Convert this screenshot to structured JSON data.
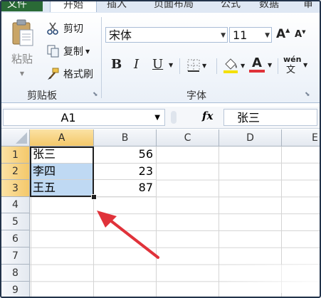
{
  "ribbon_tabs": [
    "文件",
    "开始",
    "插入",
    "页面布局",
    "公式",
    "数据",
    "审"
  ],
  "clipboard": {
    "paste_label": "粘贴",
    "cut_label": "剪切",
    "copy_label": "复制",
    "format_painter_label": "格式刷",
    "group_label": "剪贴板"
  },
  "font": {
    "name": "宋体",
    "size": "11",
    "bold_label": "B",
    "italic_label": "I",
    "underline_label": "U",
    "font_color_letter": "A",
    "grow_label": "A",
    "shrink_label": "A",
    "group_label": "字体",
    "phonetic_label": "wén"
  },
  "formula_bar": {
    "name_box": "A1",
    "fx_label": "fx",
    "content": "张三"
  },
  "columns": [
    "A",
    "B",
    "C",
    "D",
    "E"
  ],
  "rows": [
    "1",
    "2",
    "3",
    "4",
    "5",
    "6",
    "7",
    "8",
    "9"
  ],
  "cells": {
    "r1": {
      "a": "张三",
      "b": "56"
    },
    "r2": {
      "a": "李四",
      "b": "23"
    },
    "r3": {
      "a": "王五",
      "b": "87"
    }
  },
  "colors": {
    "file_tab": "#2a6a36",
    "selection_header": "#f4c86a",
    "selection_fill": "#bfd9f3",
    "arrow": "#e0323a",
    "font_color_bar": "#e0323a",
    "fill_color_bar": "#f4e000"
  },
  "icons": [
    "paste-icon",
    "scissors-icon",
    "copy-icon",
    "format-painter-icon",
    "border-icon",
    "fill-color-icon",
    "font-color-icon",
    "phonetic-icon",
    "fx-icon",
    "select-all-triangle",
    "red-arrow"
  ]
}
